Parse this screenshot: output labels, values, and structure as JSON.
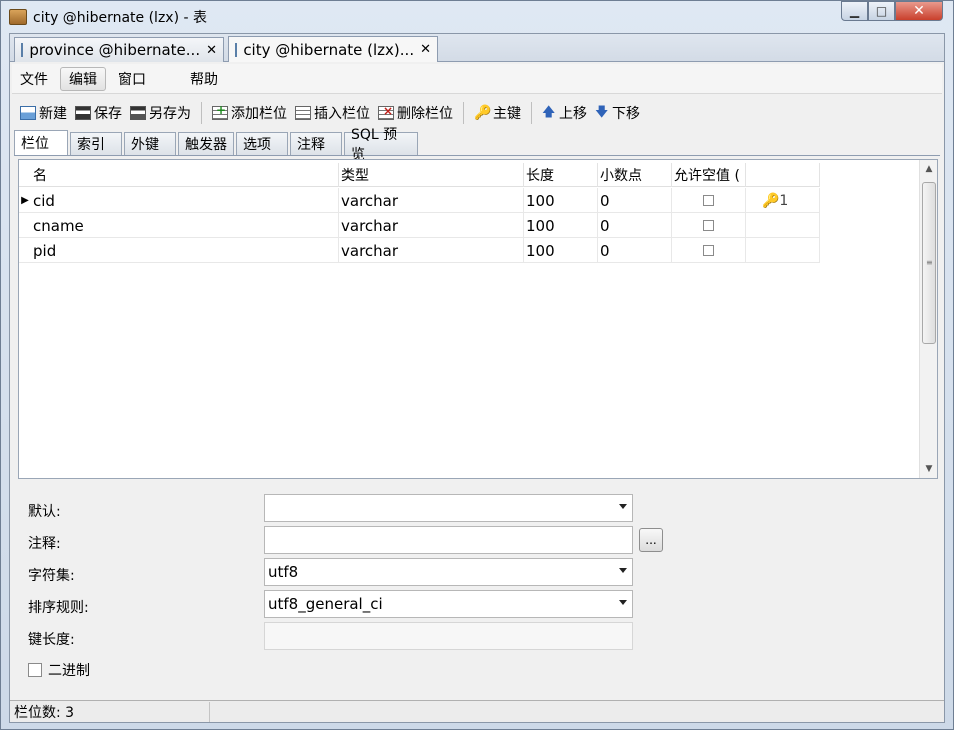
{
  "window": {
    "title": "city @hibernate (lzx) - 表",
    "controls": {
      "minimize": "▁",
      "maximize": "□",
      "close": "✕"
    }
  },
  "doc_tabs": [
    {
      "label": "province @hibernate...",
      "close": "✕",
      "icon": "table-icon"
    },
    {
      "label": "city @hibernate (lzx)...",
      "close": "✕",
      "icon": "table-icon"
    }
  ],
  "menu": {
    "file": "文件",
    "edit": "编辑",
    "window": "窗口",
    "help": "帮助"
  },
  "toolbar": {
    "new": "新建",
    "save": "保存",
    "save_as": "另存为",
    "add_field": "添加栏位",
    "insert_field": "插入栏位",
    "delete_field": "删除栏位",
    "primary_key": "主键",
    "move_up": "上移",
    "move_down": "下移",
    "key_glyph": "🔑",
    "up_glyph": "🡅",
    "down_glyph": "🡇"
  },
  "sub_tabs": [
    "栏位",
    "索引",
    "外键",
    "触发器",
    "选项",
    "注释",
    "SQL 预览"
  ],
  "grid": {
    "headers": {
      "name": "名",
      "type": "类型",
      "length": "长度",
      "decimals": "小数点",
      "allow_null": "允许空值 (",
      "key": ""
    },
    "rows": [
      {
        "indicator": "▶",
        "name": "cid",
        "type": "varchar",
        "length": "100",
        "decimals": "0",
        "allow_null": false,
        "key": "🔑1"
      },
      {
        "indicator": "",
        "name": "cname",
        "type": "varchar",
        "length": "100",
        "decimals": "0",
        "allow_null": false,
        "key": ""
      },
      {
        "indicator": "",
        "name": "pid",
        "type": "varchar",
        "length": "100",
        "decimals": "0",
        "allow_null": false,
        "key": ""
      }
    ],
    "scroll": {
      "up": "▲",
      "down": "▼",
      "grip": "≡"
    }
  },
  "props": {
    "default": {
      "label": "默认:",
      "value": ""
    },
    "comment": {
      "label": "注释:",
      "value": "",
      "button": "..."
    },
    "charset": {
      "label": "字符集:",
      "value": "utf8"
    },
    "collation": {
      "label": "排序规则:",
      "value": "utf8_general_ci"
    },
    "key_length": {
      "label": "键长度:",
      "value": ""
    },
    "binary": {
      "label": "二进制",
      "checked": false
    }
  },
  "status": {
    "text": "栏位数: 3"
  }
}
